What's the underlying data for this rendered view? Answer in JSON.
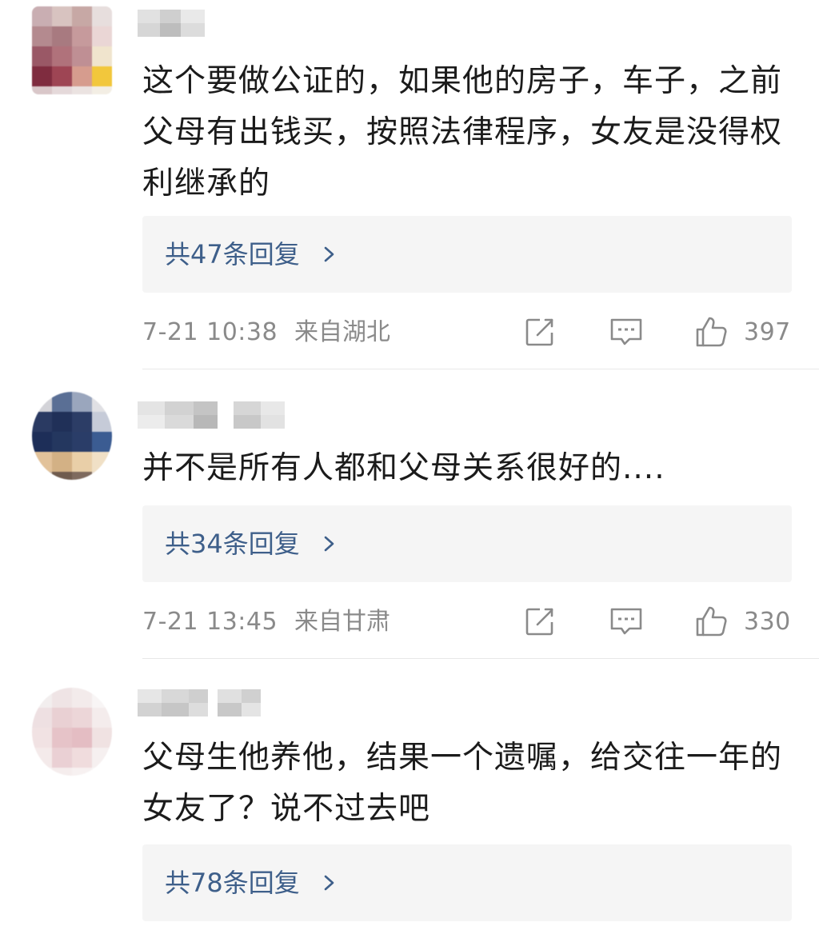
{
  "comments": [
    {
      "text": "这个要做公证的，如果他的房子，车子，之前父母有出钱买，按照法律程序，女友是没得权利继承的",
      "replies_label": "共47条回复",
      "time": "7-21 10:38",
      "location": "来自湖北",
      "likes": "397"
    },
    {
      "text": "并不是所有人都和父母关系很好的....",
      "replies_label": "共34条回复",
      "time": "7-21 13:45",
      "location": "来自甘肃",
      "likes": "330"
    },
    {
      "text": "父母生他养他，结果一个遗嘱，给交往一年的女友了？说不过去吧",
      "replies_label": "共78条回复"
    }
  ],
  "icons": {
    "share": "share-icon",
    "comment": "comment-icon",
    "like": "thumbs-up-icon",
    "chevron": "chevron-right-icon"
  },
  "colors": {
    "reply_link": "#3e5f8a",
    "meta_text": "#8a8a8a",
    "reply_box_bg": "#f5f5f5",
    "divider": "#e8e8e8"
  }
}
